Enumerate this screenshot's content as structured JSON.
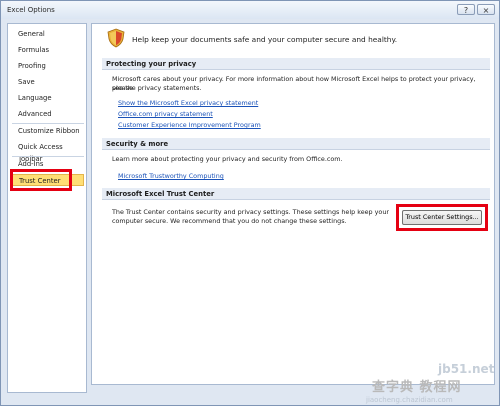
{
  "window": {
    "title": "Excel Options",
    "help_glyph": "?",
    "close_glyph": "×"
  },
  "sidebar": {
    "items": [
      {
        "label": "General"
      },
      {
        "label": "Formulas"
      },
      {
        "label": "Proofing"
      },
      {
        "label": "Save"
      },
      {
        "label": "Language"
      },
      {
        "label": "Advanced"
      },
      {
        "label": "Customize Ribbon"
      },
      {
        "label": "Quick Access Toolbar"
      },
      {
        "label": "Add-Ins"
      },
      {
        "label": "Trust Center"
      }
    ],
    "selected": "Trust Center"
  },
  "content": {
    "intro": "Help keep your documents safe and your computer secure and healthy.",
    "privacy": {
      "header": "Protecting your privacy",
      "text_line1": "Microsoft cares about your privacy. For more information about how Microsoft Excel helps to protect your privacy, please",
      "text_line2": "see the privacy statements.",
      "links": [
        "Show the Microsoft Excel privacy statement",
        "Office.com privacy statement",
        "Customer Experience Improvement Program"
      ]
    },
    "security": {
      "header": "Security & more",
      "text": "Learn more about protecting your privacy and security from Office.com.",
      "link": "Microsoft Trustworthy Computing"
    },
    "trust_center": {
      "header": "Microsoft Excel Trust Center",
      "text_line1": "The Trust Center contains security and privacy settings. These settings help keep your",
      "text_line2": "computer secure. We recommend that you do not change these settings.",
      "button_label": "Trust Center Settings..."
    }
  },
  "watermark": {
    "site": "jb51.net",
    "cn_text": "查字典 教程网",
    "url": "jiaocheng.chazidian.com"
  },
  "colors": {
    "highlight_red": "#e50012",
    "selected_bg": "#ffdf75",
    "link": "#1a52b8"
  }
}
